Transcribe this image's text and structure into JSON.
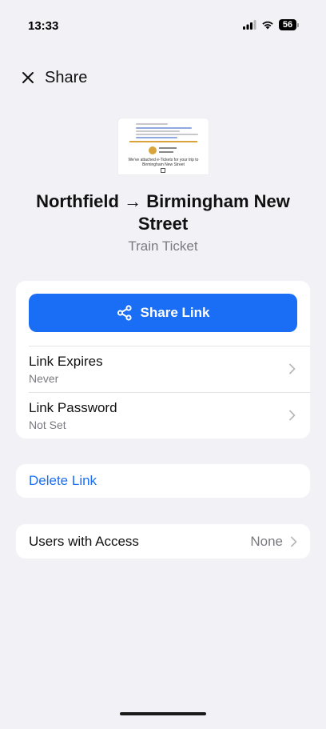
{
  "status_bar": {
    "time": "13:33",
    "battery": "56",
    "icons": [
      "cellular-signal-icon",
      "wifi-icon",
      "battery-icon"
    ]
  },
  "nav": {
    "close_icon": "close-icon",
    "title": "Share"
  },
  "document": {
    "thumbnail_text": "We've attached e-Tickets for your trip to Birmingham New Street",
    "title": "Northfield → Birmingham New Street",
    "subtitle": "Train Ticket"
  },
  "share_card": {
    "share_button_label": "Share Link",
    "share_icon": "share-icon",
    "rows": [
      {
        "label": "Link Expires",
        "value": "Never"
      },
      {
        "label": "Link Password",
        "value": "Not Set"
      }
    ]
  },
  "delete_card": {
    "label": "Delete Link"
  },
  "access_card": {
    "label": "Users with Access",
    "value": "None"
  },
  "colors": {
    "accent": "#1a6ef5",
    "background": "#f1f1f6",
    "secondary_text": "#7a7a80"
  }
}
